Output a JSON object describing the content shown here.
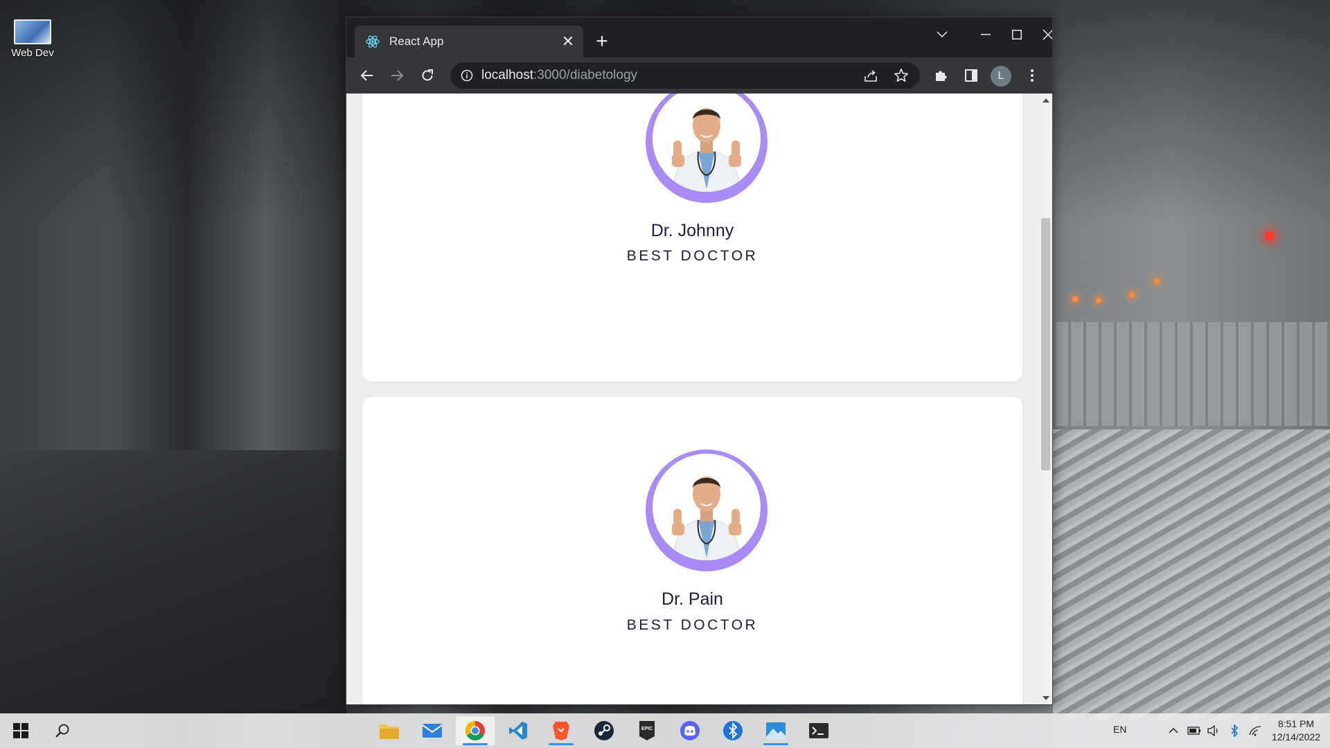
{
  "desktop": {
    "icon_label": "Web Dev"
  },
  "browser": {
    "tab_title": "React App",
    "url_host": "localhost",
    "url_path": ":3000/diabetology",
    "profile_initial": "L"
  },
  "doctors": [
    {
      "name": "Dr. Johnny",
      "title": "BEST DOCTOR"
    },
    {
      "name": "Dr. Pain",
      "title": "BEST DOCTOR"
    }
  ],
  "colors": {
    "avatar_ring": "#a98bf5",
    "text_dark": "#1f1b3a",
    "page_bg": "#eeeef1"
  },
  "taskbar": {
    "language": "EN",
    "time": "8:51 PM",
    "date": "12/14/2022",
    "apps": [
      "file-explorer",
      "mail",
      "chrome",
      "vscode",
      "brave",
      "steam",
      "epic-games",
      "discord",
      "bluetooth-app",
      "photos",
      "terminal"
    ]
  }
}
